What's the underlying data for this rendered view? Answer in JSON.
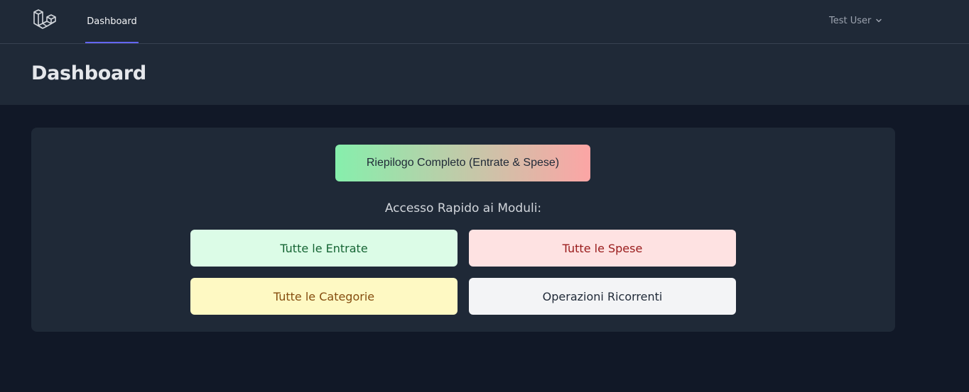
{
  "nav": {
    "logo_icon": "laravel-logo-icon",
    "links": [
      {
        "label": "Dashboard",
        "active": true
      }
    ],
    "user": {
      "name": "Test User",
      "icon": "chevron-down-icon"
    },
    "accent": "#6366f1"
  },
  "header": {
    "title": "Dashboard"
  },
  "main": {
    "summary_button": {
      "label": "Riepilogo Completo (Entrate & Spese)",
      "gradient": [
        "#86efac",
        "#fca5a5"
      ]
    },
    "quick_access_heading": "Accesso Rapido ai Moduli:",
    "modules": [
      {
        "label": "Tutte le Entrate",
        "bg": "#dcfce7",
        "color": "#166534"
      },
      {
        "label": "Tutte le Spese",
        "bg": "#fee2e2",
        "color": "#991b1b"
      },
      {
        "label": "Tutte le Categorie",
        "bg": "#fef9c3",
        "color": "#854d0e"
      },
      {
        "label": "Operazioni Ricorrenti",
        "bg": "#f3f4f6",
        "color": "#1f2937"
      }
    ]
  },
  "colors": {
    "background": "#111827",
    "surface": "#1f2937",
    "border": "#374151"
  }
}
